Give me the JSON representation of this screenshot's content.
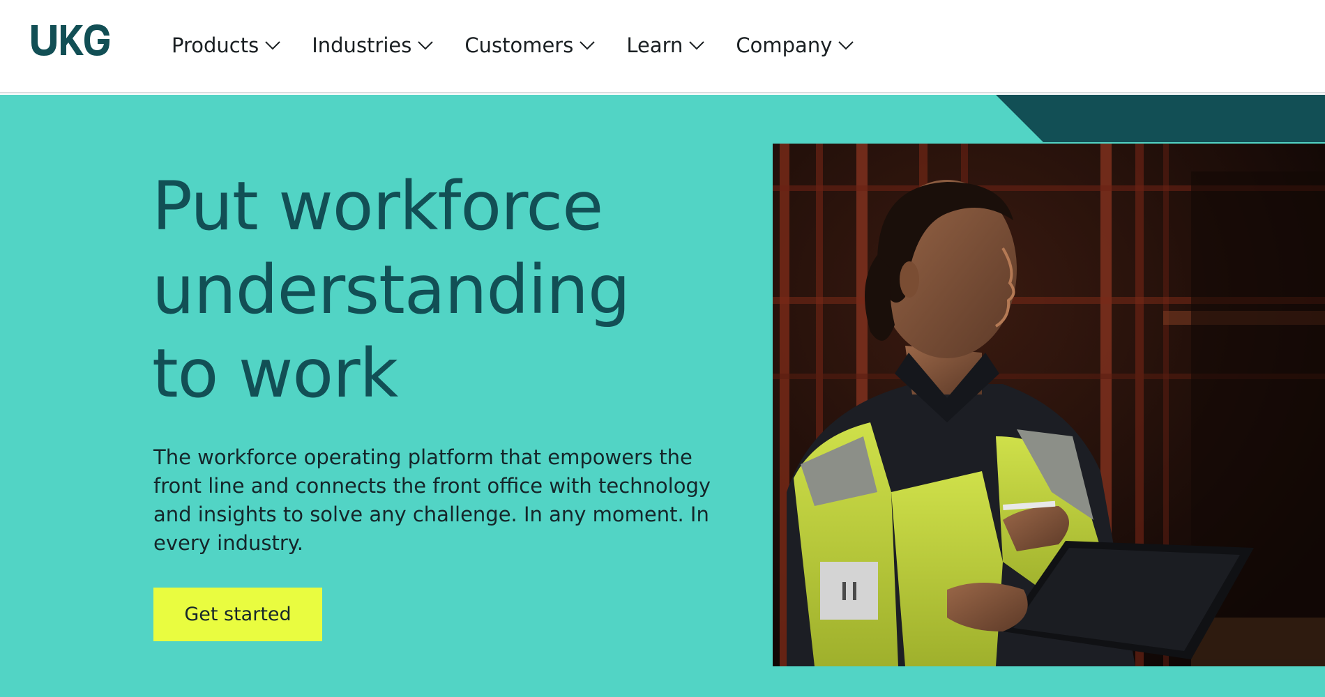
{
  "brand": {
    "logo_text": "UKG",
    "logo_color": "#124f55"
  },
  "nav": {
    "items": [
      {
        "label": "Products",
        "icon": "chevron-down-icon"
      },
      {
        "label": "Industries",
        "icon": "chevron-down-icon"
      },
      {
        "label": "Customers",
        "icon": "chevron-down-icon"
      },
      {
        "label": "Learn",
        "icon": "chevron-down-icon"
      },
      {
        "label": "Company",
        "icon": "chevron-down-icon"
      }
    ]
  },
  "hero": {
    "title_line1": "Put workforce",
    "title_line2": "understanding",
    "title_line3": "to work",
    "subtitle": "The workforce operating platform that empowers the front line and connects the front office with technology and insights to solve any challenge. In any moment. In every industry.",
    "cta_label": "Get started",
    "video_control_icon": "pause-icon"
  },
  "colors": {
    "hero_background": "#52d4c5",
    "hero_title": "#124f55",
    "accent_dark": "#124f55",
    "cta_background": "#e9fc40",
    "cta_text": "#15262a"
  }
}
